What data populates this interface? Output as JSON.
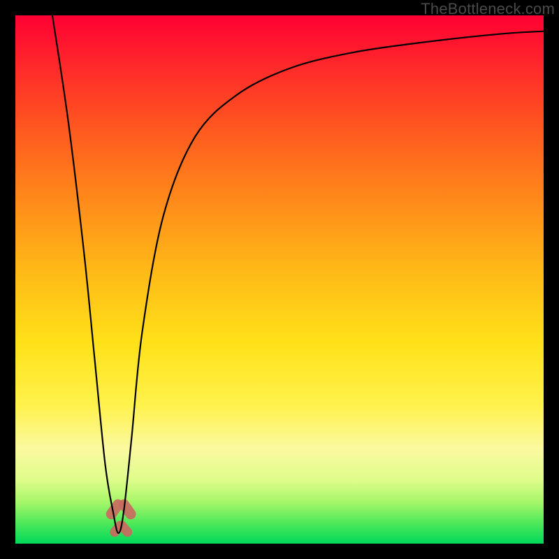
{
  "watermark": "TheBottleneck.com",
  "chart_data": {
    "type": "line",
    "title": "",
    "xlabel": "",
    "ylabel": "",
    "xlim": [
      0,
      100
    ],
    "ylim": [
      0,
      100
    ],
    "legend": false,
    "grid": false,
    "background_gradient": [
      "#ff0033",
      "#ffe119",
      "#00d85a"
    ],
    "series": [
      {
        "name": "bottleneck-curve",
        "color": "#000000",
        "x": [
          7,
          10,
          13,
          15,
          17,
          18.5,
          19.5,
          20.5,
          22,
          24,
          28,
          34,
          42,
          52,
          64,
          78,
          92,
          100
        ],
        "values": [
          100,
          80,
          55,
          35,
          15,
          6,
          2,
          6,
          20,
          40,
          62,
          77,
          85,
          90,
          93,
          95,
          96.5,
          97
        ]
      }
    ],
    "markers": [
      {
        "name": "cusp-marker-upper-left",
        "shape": "pill",
        "x": 18.8,
        "y": 6.5,
        "rotation": -55,
        "width": 4.2,
        "height": 2.0,
        "color": "#c96a5f"
      },
      {
        "name": "cusp-marker-upper-right",
        "shape": "pill",
        "x": 21.2,
        "y": 6.5,
        "rotation": 55,
        "width": 4.2,
        "height": 2.0,
        "color": "#c96a5f"
      },
      {
        "name": "cusp-marker-lower-left",
        "shape": "pill",
        "x": 19.3,
        "y": 2.8,
        "rotation": -50,
        "width": 3.4,
        "height": 1.8,
        "color": "#c96a5f"
      },
      {
        "name": "cusp-marker-lower-right",
        "shape": "pill",
        "x": 20.7,
        "y": 2.8,
        "rotation": 50,
        "width": 3.4,
        "height": 1.8,
        "color": "#c96a5f"
      }
    ]
  }
}
